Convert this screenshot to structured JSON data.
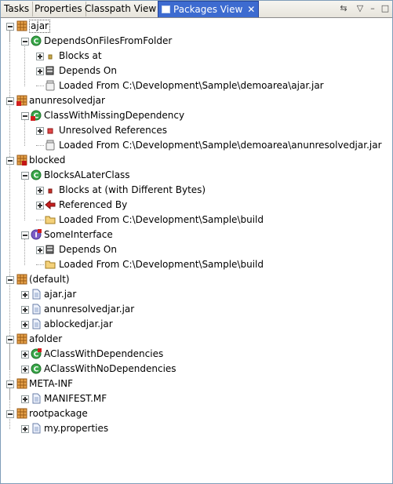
{
  "tabs": [
    {
      "label": "Tasks",
      "active": false
    },
    {
      "label": "Properties",
      "active": false
    },
    {
      "label": "Classpath View",
      "active": false
    },
    {
      "label": "Packages View",
      "active": true
    }
  ],
  "toolbar": {
    "buttons": [
      "sync-icon",
      "view-menu-icon",
      "minimize-icon",
      "maximize-icon"
    ]
  },
  "tree": [
    {
      "label": "ajar",
      "icon": "package-icon",
      "expanded": true
    },
    {
      "label": "DependsOnFilesFromFolder",
      "icon": "class-icon",
      "expanded": true
    },
    {
      "label": "Blocks at",
      "icon": "dot-icon",
      "expanded": false
    },
    {
      "label": "Depends On",
      "icon": "books-icon",
      "expanded": false
    },
    {
      "label": "Loaded From C:\\Development\\Sample\\demoarea\\ajar.jar",
      "icon": "jar-icon"
    },
    {
      "label": "anunresolvedjar",
      "icon": "package-error-icon",
      "expanded": true
    },
    {
      "label": "ClassWithMissingDependency",
      "icon": "class-error-icon",
      "expanded": true
    },
    {
      "label": "Unresolved References",
      "icon": "error-dot-icon",
      "expanded": false
    },
    {
      "label": "Loaded From C:\\Development\\Sample\\demoarea\\anunresolvedjar.jar",
      "icon": "jar-icon"
    },
    {
      "label": "blocked",
      "icon": "package-blocked-icon",
      "expanded": true
    },
    {
      "label": "BlocksALaterClass",
      "icon": "class-icon",
      "expanded": true
    },
    {
      "label": "Blocks at (with Different Bytes)",
      "icon": "red-dot-icon",
      "expanded": false
    },
    {
      "label": "Referenced By",
      "icon": "red-arrow-icon",
      "expanded": false
    },
    {
      "label": "Loaded From C:\\Development\\Sample\\build",
      "icon": "folder-icon"
    },
    {
      "label": "SomeInterface",
      "icon": "interface-icon",
      "expanded": true
    },
    {
      "label": "Depends On",
      "icon": "books-icon",
      "expanded": false
    },
    {
      "label": "Loaded From C:\\Development\\Sample\\build",
      "icon": "folder-icon"
    },
    {
      "label": "(default)",
      "icon": "package-icon",
      "expanded": true
    },
    {
      "label": "ajar.jar",
      "icon": "file-icon",
      "expanded": false
    },
    {
      "label": "anunresolvedjar.jar",
      "icon": "file-icon",
      "expanded": false
    },
    {
      "label": "ablockedjar.jar",
      "icon": "file-icon",
      "expanded": false
    },
    {
      "label": "afolder",
      "icon": "package-icon",
      "expanded": true
    },
    {
      "label": "AClassWithDependencies",
      "icon": "class-warn-icon",
      "expanded": false
    },
    {
      "label": "AClassWithNoDependencies",
      "icon": "class-icon",
      "expanded": false
    },
    {
      "label": "META-INF",
      "icon": "package-icon",
      "expanded": true
    },
    {
      "label": "MANIFEST.MF",
      "icon": "file-icon",
      "expanded": false
    },
    {
      "label": "rootpackage",
      "icon": "package-icon",
      "expanded": true
    },
    {
      "label": "my.properties",
      "icon": "file-icon",
      "expanded": false
    }
  ],
  "colors": {
    "tab_active": "#3d6bd0",
    "package": "#c17a25",
    "class": "#2f9a3c",
    "error": "#d21e1e"
  }
}
